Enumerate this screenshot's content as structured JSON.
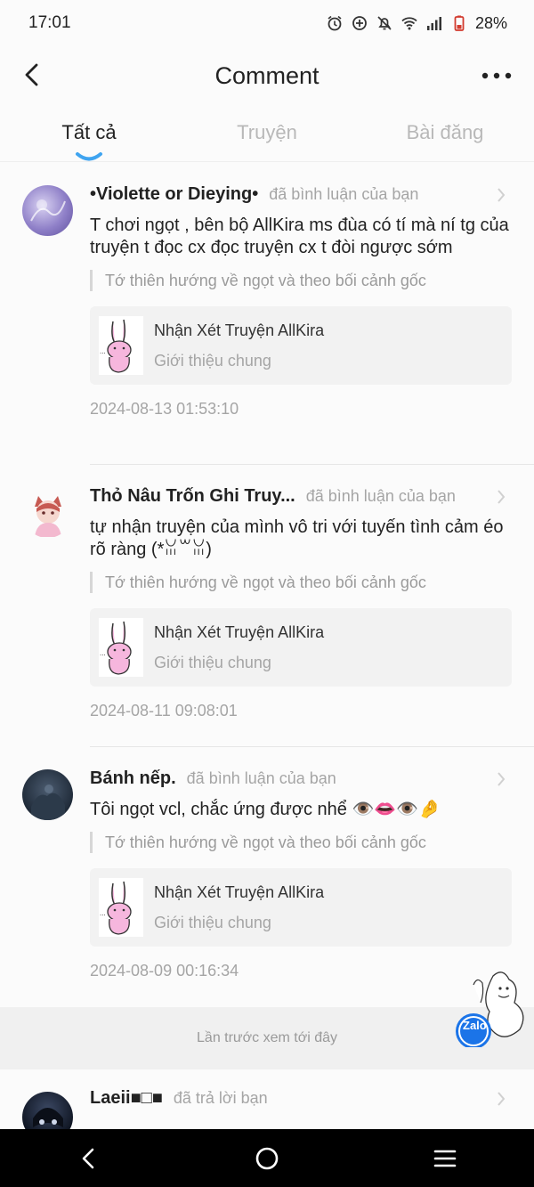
{
  "status_bar": {
    "time": "17:01",
    "battery": "28%"
  },
  "header": {
    "title": "Comment"
  },
  "tabs": [
    {
      "label": "Tất cả",
      "active": true
    },
    {
      "label": "Truyện",
      "active": false
    },
    {
      "label": "Bài đăng",
      "active": false
    }
  ],
  "comments": [
    {
      "user": "•Violette or Dieying•",
      "action": "đã bình luận của bạn",
      "text": "T chơi ngọt , bên bộ AllKira ms đùa có tí mà ní tg của truyện t đọc cx đọc truyện cx t đòi ngược sớm",
      "quote": "Tớ thiên hướng về ngọt và theo bối cảnh gốc",
      "card_title": "Nhận Xét Truyện AllKira",
      "card_sub": "Giới thiệu chung",
      "date": "2024-08-13 01:53:10"
    },
    {
      "user": "Thỏ Nâu Trốn Ghi Truy...",
      "action": "đã bình luận của bạn",
      "text": "tự nhận truyện của mình vô tri với tuyến tình cảm éo rõ ràng (*ꈍ꒳ꈍ)",
      "quote": "Tớ thiên hướng về ngọt và theo bối cảnh gốc",
      "card_title": "Nhận Xét Truyện AllKira",
      "card_sub": "Giới thiệu chung",
      "date": "2024-08-11 09:08:01"
    },
    {
      "user": "Bánh nếp.",
      "action": "đã bình luận của bạn",
      "text": "Tôi ngọt vcl, chắc ứng được nhể 👁️👄👁️🤌",
      "quote": "Tớ thiên hướng về ngọt và theo bối cảnh gốc",
      "card_title": "Nhận Xét Truyện AllKira",
      "card_sub": "Giới thiệu chung",
      "date": "2024-08-09 00:16:34"
    }
  ],
  "seen_marker": "Lần trước xem tới đây",
  "last_item": {
    "user": "Laeii■□■",
    "action": "đã trả lời bạn"
  },
  "zalo_label": "Zalo",
  "colors": {
    "accent_blue": "#3fa4f0",
    "zalo_blue": "#1b74e8"
  }
}
